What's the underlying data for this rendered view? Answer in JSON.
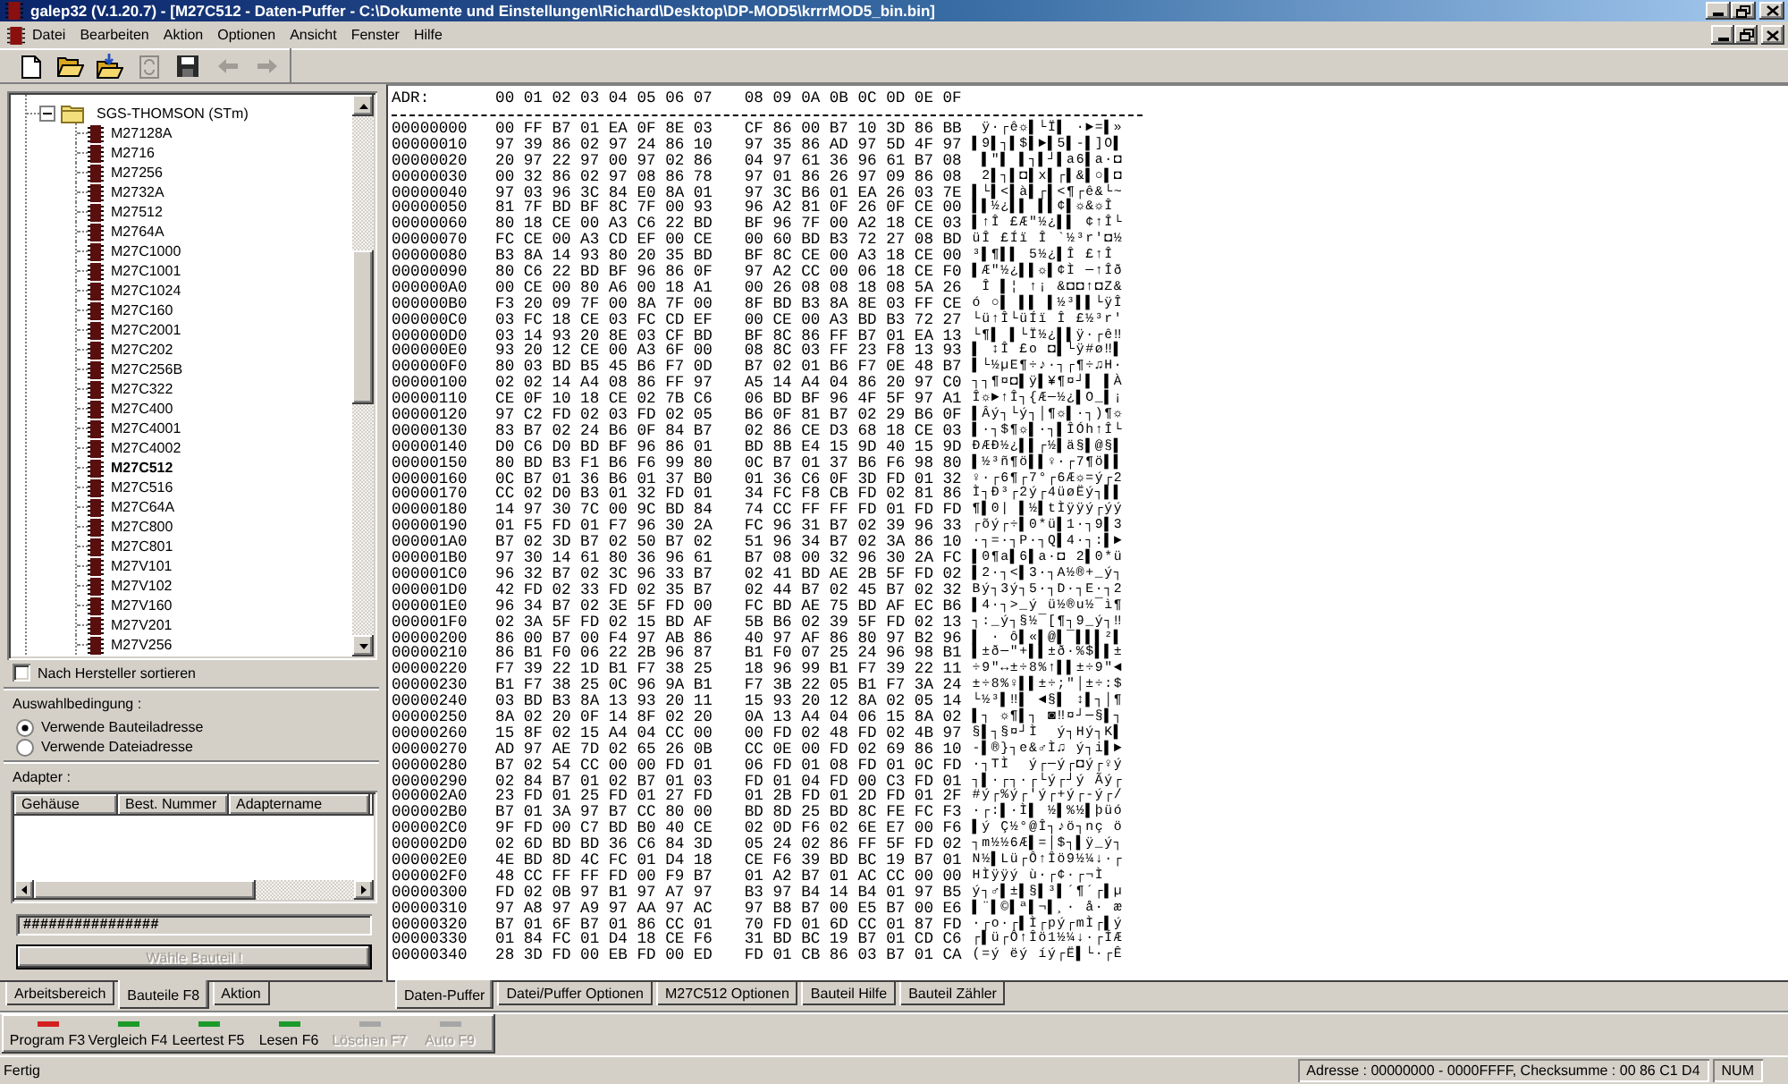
{
  "window": {
    "title": "galep32 (V.1.20.7) - [M27C512 - Daten-Puffer - C:\\Dokumente und Einstellungen\\Richard\\Desktop\\DP-MOD5\\krrrMOD5_bin.bin]"
  },
  "menu": [
    "Datei",
    "Bearbeiten",
    "Aktion",
    "Optionen",
    "Ansicht",
    "Fenster",
    "Hilfe"
  ],
  "toolbar": [
    {
      "kind": "new",
      "disabled": false
    },
    {
      "kind": "open",
      "disabled": false
    },
    {
      "kind": "load",
      "disabled": false
    },
    {
      "kind": "refresh",
      "disabled": true
    },
    {
      "kind": "save",
      "disabled": false
    },
    {
      "kind": "back",
      "disabled": true
    },
    {
      "kind": "forward",
      "disabled": true
    }
  ],
  "device_tree": {
    "group": {
      "label": "SGS-THOMSON (STm)",
      "expanded": true,
      "children": [
        {
          "label": "M27128A",
          "selected": false
        },
        {
          "label": "M2716",
          "selected": false
        },
        {
          "label": "M27256",
          "selected": false
        },
        {
          "label": "M2732A",
          "selected": false
        },
        {
          "label": "M27512",
          "selected": false
        },
        {
          "label": "M2764A",
          "selected": false
        },
        {
          "label": "M27C1000",
          "selected": false
        },
        {
          "label": "M27C1001",
          "selected": false
        },
        {
          "label": "M27C1024",
          "selected": false
        },
        {
          "label": "M27C160",
          "selected": false
        },
        {
          "label": "M27C2001",
          "selected": false
        },
        {
          "label": "M27C202",
          "selected": false
        },
        {
          "label": "M27C256B",
          "selected": false
        },
        {
          "label": "M27C322",
          "selected": false
        },
        {
          "label": "M27C400",
          "selected": false
        },
        {
          "label": "M27C4001",
          "selected": false
        },
        {
          "label": "M27C4002",
          "selected": false
        },
        {
          "label": "M27C512",
          "selected": true
        },
        {
          "label": "M27C516",
          "selected": false
        },
        {
          "label": "M27C64A",
          "selected": false
        },
        {
          "label": "M27C800",
          "selected": false
        },
        {
          "label": "M27C801",
          "selected": false
        },
        {
          "label": "M27V101",
          "selected": false
        },
        {
          "label": "M27V102",
          "selected": false
        },
        {
          "label": "M27V160",
          "selected": false
        },
        {
          "label": "M27V201",
          "selected": false
        },
        {
          "label": "M27V256",
          "selected": false
        }
      ]
    }
  },
  "sort_by_manufacturer": {
    "label": "Nach Hersteller sortieren",
    "checked": false
  },
  "selection_condition": {
    "label": "Auswahlbedingung :",
    "options": [
      {
        "label": "Verwende Bauteiladresse",
        "selected": true
      },
      {
        "label": "Verwende Dateiadresse",
        "selected": false
      }
    ]
  },
  "adapter": {
    "label": "Adapter :",
    "columns": [
      "Gehäuse",
      "Best. Nummer",
      "Adaptername"
    ]
  },
  "progress_field": {
    "value": "################"
  },
  "select_button": {
    "label": "Wähle Bauteil !",
    "disabled": true
  },
  "left_tabs": [
    {
      "label": "Arbeitsbereich",
      "selected": false
    },
    {
      "label": "Bauteile F8",
      "selected": true
    },
    {
      "label": "Aktion",
      "selected": false
    }
  ],
  "hex_view": {
    "address_header": "ADR:",
    "column_headers": [
      "00 01 02 03 04 05 06 07",
      "08 09 0A 0B 0C 0D 0E 0F"
    ],
    "rows": [
      {
        "address": "00000000",
        "bytes": [
          "00 FF B7 01 EA 0F 8E 03",
          "CF 86 00 B7 10 3D 86 BB"
        ],
        "ascii": " ÿ·┌ê☼▌└Ï▌ ·►=▌»"
      },
      {
        "address": "00000010",
        "bytes": [
          "97 39 86 02 97 24 86 10",
          "97 35 86 AD 97 5D 4F 97"
        ],
        "ascii": "▌9▌┐▌$▌►▌5▌-▌]O▌"
      },
      {
        "address": "00000020",
        "bytes": [
          "20 97 22 97 00 97 02 86",
          "04 97 61 36 96 61 B7 08"
        ],
        "ascii": " ▌\"▌ ▌┐▌┘▌a6▌a·◘"
      },
      {
        "address": "00000030",
        "bytes": [
          "00 32 86 02 97 08 86 78",
          "97 01 86 26 97 09 86 08"
        ],
        "ascii": " 2▌┐▌◘▌x▌┌▌&▌○▌◘"
      },
      {
        "address": "00000040",
        "bytes": [
          "97 03 96 3C 84 E0 8A 01",
          "97 3C B6 01 EA 26 03 7E"
        ],
        "ascii": "▌└▌<▌à▌┌▌<¶┌ê&└~"
      },
      {
        "address": "00000050",
        "bytes": [
          "81 7F BD BF 8C 7F 00 93",
          "96 A2 81 0F 26 0F CE 00"
        ],
        "ascii": "▌▌½¿▌▌ ▌▌¢▌☼&☼Î "
      },
      {
        "address": "00000060",
        "bytes": [
          "80 18 CE 00 A3 C6 22 BD",
          "BF 96 7F 00 A2 18 CE 03"
        ],
        "ascii": "▌↑Î £Æ\"½¿▌▌ ¢↑Î└"
      },
      {
        "address": "00000070",
        "bytes": [
          "FC CE 00 A3 CD EF 00 CE",
          "00 60 BD B3 72 27 08 BD"
        ],
        "ascii": "üÎ £Íï Î `½³r'◘½"
      },
      {
        "address": "00000080",
        "bytes": [
          "B3 8A 14 93 80 20 35 BD",
          "BF 8C CE 00 A3 18 CE 00"
        ],
        "ascii": "³▌¶▌▌ 5½¿▌Î £↑Î "
      },
      {
        "address": "00000090",
        "bytes": [
          "80 C6 22 BD BF 96 86 0F",
          "97 A2 CC 00 06 18 CE F0"
        ],
        "ascii": "▌Æ\"½¿▌▌☼▌¢Ì ─↑Îð"
      },
      {
        "address": "000000A0",
        "bytes": [
          "00 CE 00 80 A6 00 18 A1",
          "00 26 08 08 18 08 5A 26"
        ],
        "ascii": " Î ▌¦ ↑¡ &◘◘↑◘Z&"
      },
      {
        "address": "000000B0",
        "bytes": [
          "F3 20 09 7F 00 8A 7F 00",
          "8F BD B3 8A 8E 03 FF CE"
        ],
        "ascii": "ó ○▌ ▌▌ ▌½³▌▌└ÿÎ"
      },
      {
        "address": "000000C0",
        "bytes": [
          "03 FC 18 CE 03 FC CD EF",
          "00 CE 00 A3 BD B3 72 27"
        ],
        "ascii": "└ü↑Î└üÍï Î £½³r'"
      },
      {
        "address": "000000D0",
        "bytes": [
          "03 14 93 20 8E 03 CF BD",
          "BF 8C 86 FF B7 01 EA 13"
        ],
        "ascii": "└¶▌ ▌└Ï½¿▌▌ÿ·┌ê‼"
      },
      {
        "address": "000000E0",
        "bytes": [
          "93 20 12 CE 00 A3 6F 00",
          "08 8C 03 FF 23 F8 13 93"
        ],
        "ascii": "▌ ↕Î £o ◘▌└ÿ#ø‼▌"
      },
      {
        "address": "000000F0",
        "bytes": [
          "80 03 BD B5 45 B6 F7 0D",
          "B7 02 01 B6 F7 0E 48 B7"
        ],
        "ascii": "▌└½µE¶÷♪·┐┌¶÷♫H·"
      },
      {
        "address": "00000100",
        "bytes": [
          "02 02 14 A4 08 86 FF 97",
          "A5 14 A4 04 86 20 97 C0"
        ],
        "ascii": "┐┐¶¤◘▌ÿ▌¥¶¤┘▌ ▌À"
      },
      {
        "address": "00000110",
        "bytes": [
          "CE 0F 10 18 CE 02 7B C6",
          "06 BD BF 96 4F 5F 97 A1"
        ],
        "ascii": "Î☼►↑Î┐{Æ─½¿▌O_▌¡"
      },
      {
        "address": "00000120",
        "bytes": [
          "97 C2 FD 02 03 FD 02 05",
          "B6 0F 81 B7 02 29 B6 0F"
        ],
        "ascii": "▌Âý┐└ý┐│¶☼▌·┐)¶☼"
      },
      {
        "address": "00000130",
        "bytes": [
          "83 B7 02 24 B6 0F 84 B7",
          "02 86 CE D3 68 18 CE 03"
        ],
        "ascii": "▌·┐$¶☼▌·┐▌ÎÓh↑Î└"
      },
      {
        "address": "00000140",
        "bytes": [
          "D0 C6 D0 BD BF 96 86 01",
          "BD 8B E4 15 9D 40 15 9D"
        ],
        "ascii": "ÐÆÐ½¿▌▌┌½▌ä§▌@§▌"
      },
      {
        "address": "00000150",
        "bytes": [
          "80 BD B3 F1 B6 F6 99 80",
          "0C B7 01 37 B6 F6 98 80"
        ],
        "ascii": "▌½³ñ¶ö▌▌♀·┌7¶ö▌▌"
      },
      {
        "address": "00000160",
        "bytes": [
          "0C B7 01 36 B6 01 37 B0",
          "01 36 C6 0F 3D FD 01 32"
        ],
        "ascii": "♀·┌6¶┌7°┌6Æ☼=ý┌2"
      },
      {
        "address": "00000170",
        "bytes": [
          "CC 02 D0 B3 01 32 FD 01",
          "34 FC F8 CB FD 02 81 86"
        ],
        "ascii": "Ì┐Ð³┌2ý┌4üøËý┐▌▌"
      },
      {
        "address": "00000180",
        "bytes": [
          "14 97 30 7C 00 9C BD 84",
          "74 CC FF FF FD 01 FD FD"
        ],
        "ascii": "¶▌0| ▌½▌tÌÿÿý┌ýý"
      },
      {
        "address": "00000190",
        "bytes": [
          "01 F5 FD 01 F7 96 30 2A",
          "FC 96 31 B7 02 39 96 33"
        ],
        "ascii": "┌õý┌÷▌0*ü▌1·┐9▌3"
      },
      {
        "address": "000001A0",
        "bytes": [
          "B7 02 3D B7 02 50 B7 02",
          "51 96 34 B7 02 3A 86 10"
        ],
        "ascii": "·┐=·┐P·┐Q▌4·┐:▌►"
      },
      {
        "address": "000001B0",
        "bytes": [
          "97 30 14 61 80 36 96 61",
          "B7 08 00 32 96 30 2A FC"
        ],
        "ascii": "▌0¶a▌6▌a·◘ 2▌0*ü"
      },
      {
        "address": "000001C0",
        "bytes": [
          "96 32 B7 02 3C 96 33 B7",
          "02 41 BD AE 2B 5F FD 02"
        ],
        "ascii": "▌2·┐<▌3·┐A½®+_ý┐"
      },
      {
        "address": "000001D0",
        "bytes": [
          "42 FD 02 33 FD 02 35 B7",
          "02 44 B7 02 45 B7 02 32"
        ],
        "ascii": "Bý┐3ý┐5·┐D·┐E·┐2"
      },
      {
        "address": "000001E0",
        "bytes": [
          "96 34 B7 02 3E 5F FD 00",
          "FC BD AE 75 BD AF EC B6"
        ],
        "ascii": "▌4·┐>_ý ü½®u½¯ì¶"
      },
      {
        "address": "000001F0",
        "bytes": [
          "02 3A 5F FD 02 15 BD AF",
          "5B B6 02 39 5F FD 02 13"
        ],
        "ascii": "┐:_ý┐§½¯[¶┐9_ý┐‼"
      },
      {
        "address": "00000200",
        "bytes": [
          "86 00 B7 00 F4 97 AB 86",
          "40 97 AF 86 80 97 B2 96"
        ],
        "ascii": "▌ · ô▌«▌@▌¯▌▌▌²▌"
      },
      {
        "address": "00000210",
        "bytes": [
          "86 B1 F0 06 22 2B 96 87",
          "B1 F0 07 25 24 96 98 B1"
        ],
        "ascii": "▌±ð─\"+▌▌±ð·%$▌▌±"
      },
      {
        "address": "00000220",
        "bytes": [
          "F7 39 22 1D B1 F7 38 25",
          "18 96 99 B1 F7 39 22 11"
        ],
        "ascii": "÷9\"↔±÷8%↑▌▌±÷9\"◄"
      },
      {
        "address": "00000230",
        "bytes": [
          "B1 F7 38 25 0C 96 9A B1",
          "F7 3B 22 05 B1 F7 3A 24"
        ],
        "ascii": "±÷8%♀▌▌±÷;\"│±÷:$"
      },
      {
        "address": "00000240",
        "bytes": [
          "03 BD B3 8A 13 93 20 11",
          "15 93 20 12 8A 02 05 14"
        ],
        "ascii": "└½³▌‼▌ ◄§▌ ↕▌┐│¶"
      },
      {
        "address": "00000250",
        "bytes": [
          "8A 02 20 0F 14 8F 02 20",
          "0A 13 A4 04 06 15 8A 02"
        ],
        "ascii": "▌┐ ☼¶▌┐ ◙‼¤┘─§▌┐"
      },
      {
        "address": "00000260",
        "bytes": [
          "15 8F 02 15 A4 04 CC 00",
          "00 FD 02 48 FD 02 4B 97"
        ],
        "ascii": "§▌┐§¤┘Ì  ý┐Hý┐K▌"
      },
      {
        "address": "00000270",
        "bytes": [
          "AD 97 AE 7D 02 65 26 0B",
          "CC 0E 00 FD 02 69 86 10"
        ],
        "ascii": "-▌®}┐e&♂Ì♫ ý┐i▌►"
      },
      {
        "address": "00000280",
        "bytes": [
          "B7 02 54 CC 00 00 FD 01",
          "06 FD 01 08 FD 01 0C FD"
        ],
        "ascii": "·┐TÌ  ý┌─ý┌◘ý┌♀ý"
      },
      {
        "address": "00000290",
        "bytes": [
          "02 84 B7 01 02 B7 01 03",
          "FD 01 04 FD 00 C3 FD 01"
        ],
        "ascii": "┐▌·┌┐·┌└ý┌┘ý Ãý┌"
      },
      {
        "address": "000002A0",
        "bytes": [
          "23 FD 01 25 FD 01 27 FD",
          "01 2B FD 01 2D FD 01 2F"
        ],
        "ascii": "#ý┌%ý┌'ý┌+ý┌-ý┌/"
      },
      {
        "address": "000002B0",
        "bytes": [
          "B7 01 3A 97 B7 CC 80 00",
          "BD 8D 25 BD 8C FE FC F3"
        ],
        "ascii": "·┌:▌·Ì▌ ½▌%½▌þüó"
      },
      {
        "address": "000002C0",
        "bytes": [
          "9F FD 00 C7 BD B0 40 CE",
          "02 0D F6 02 6E E7 00 F6"
        ],
        "ascii": "▌ý Ç½°@Î┐♪ö┐nç ö"
      },
      {
        "address": "000002D0",
        "bytes": [
          "02 6D BD BD 36 C6 84 3D",
          "05 24 02 86 FF 5F FD 02"
        ],
        "ascii": "┐m½½6Æ▌=│$┐▌ÿ_ý┐"
      },
      {
        "address": "000002E0",
        "bytes": [
          "4E BD 8D 4C FC 01 D4 18",
          "CE F6 39 BD BC 19 B7 01"
        ],
        "ascii": "N½▌Lü┌Ô↑Îö9½¼↓·┌"
      },
      {
        "address": "000002F0",
        "bytes": [
          "48 CC FF FF FD 00 F9 B7",
          "01 A2 B7 01 AC CC 00 00"
        ],
        "ascii": "HÌÿÿý ù·┌¢·┌¬Ì  "
      },
      {
        "address": "00000300",
        "bytes": [
          "FD 02 0B 97 B1 97 A7 97",
          "B3 97 B4 14 B4 01 97 B5"
        ],
        "ascii": "ý┐♂▌±▌§▌³▌´¶´┌▌µ"
      },
      {
        "address": "00000310",
        "bytes": [
          "97 A8 97 A9 97 AA 97 AC",
          "97 B8 B7 00 E5 B7 00 E6"
        ],
        "ascii": "▌¨▌©▌ª▌¬▌¸· å· æ"
      },
      {
        "address": "00000320",
        "bytes": [
          "B7 01 6F B7 01 86 CC 01",
          "70 FD 01 6D CC 01 87 FD"
        ],
        "ascii": "·┌o·┌▌Ì┌pý┌mÌ┌▌ý"
      },
      {
        "address": "00000330",
        "bytes": [
          "01 84 FC 01 D4 18 CE F6",
          "31 BD BC 19 B7 01 CD C6"
        ],
        "ascii": "┌▌ü┌Ô↑Îö1½¼↓·┌ÍÆ"
      },
      {
        "address": "00000340",
        "bytes": [
          "28 3D FD 00 EB FD 00 ED",
          "FD 01 CB 86 03 B7 01 CA"
        ],
        "ascii": "(=ý ëý íý┌Ë▌└·┌Ê"
      }
    ]
  },
  "buffer_tabs": [
    {
      "label": "Daten-Puffer",
      "selected": true
    },
    {
      "label": "Datei/Puffer Optionen",
      "selected": false
    },
    {
      "label": "M27C512 Optionen",
      "selected": false
    },
    {
      "label": "Bauteil Hilfe",
      "selected": false
    },
    {
      "label": "Bauteil Zähler",
      "selected": false
    }
  ],
  "actions": [
    {
      "label": "Program F3",
      "disabled": false,
      "color": "#d42020"
    },
    {
      "label": "Vergleich F4",
      "disabled": false,
      "color": "#1c9a2a"
    },
    {
      "label": "Leertest F5",
      "disabled": false,
      "color": "#1c9a2a"
    },
    {
      "label": "Lesen F6",
      "disabled": false,
      "color": "#1c9a2a"
    },
    {
      "label": "Löschen F7",
      "disabled": true,
      "color": "#a6a6a6"
    },
    {
      "label": "Auto F9",
      "disabled": true,
      "color": "#a6a6a6"
    }
  ],
  "status_bar": {
    "message": "Fertig",
    "info": "Adresse : 00000000 - 0000FFFF, Checksumme : 00 86 C1 D4",
    "num_lock": "NUM"
  }
}
